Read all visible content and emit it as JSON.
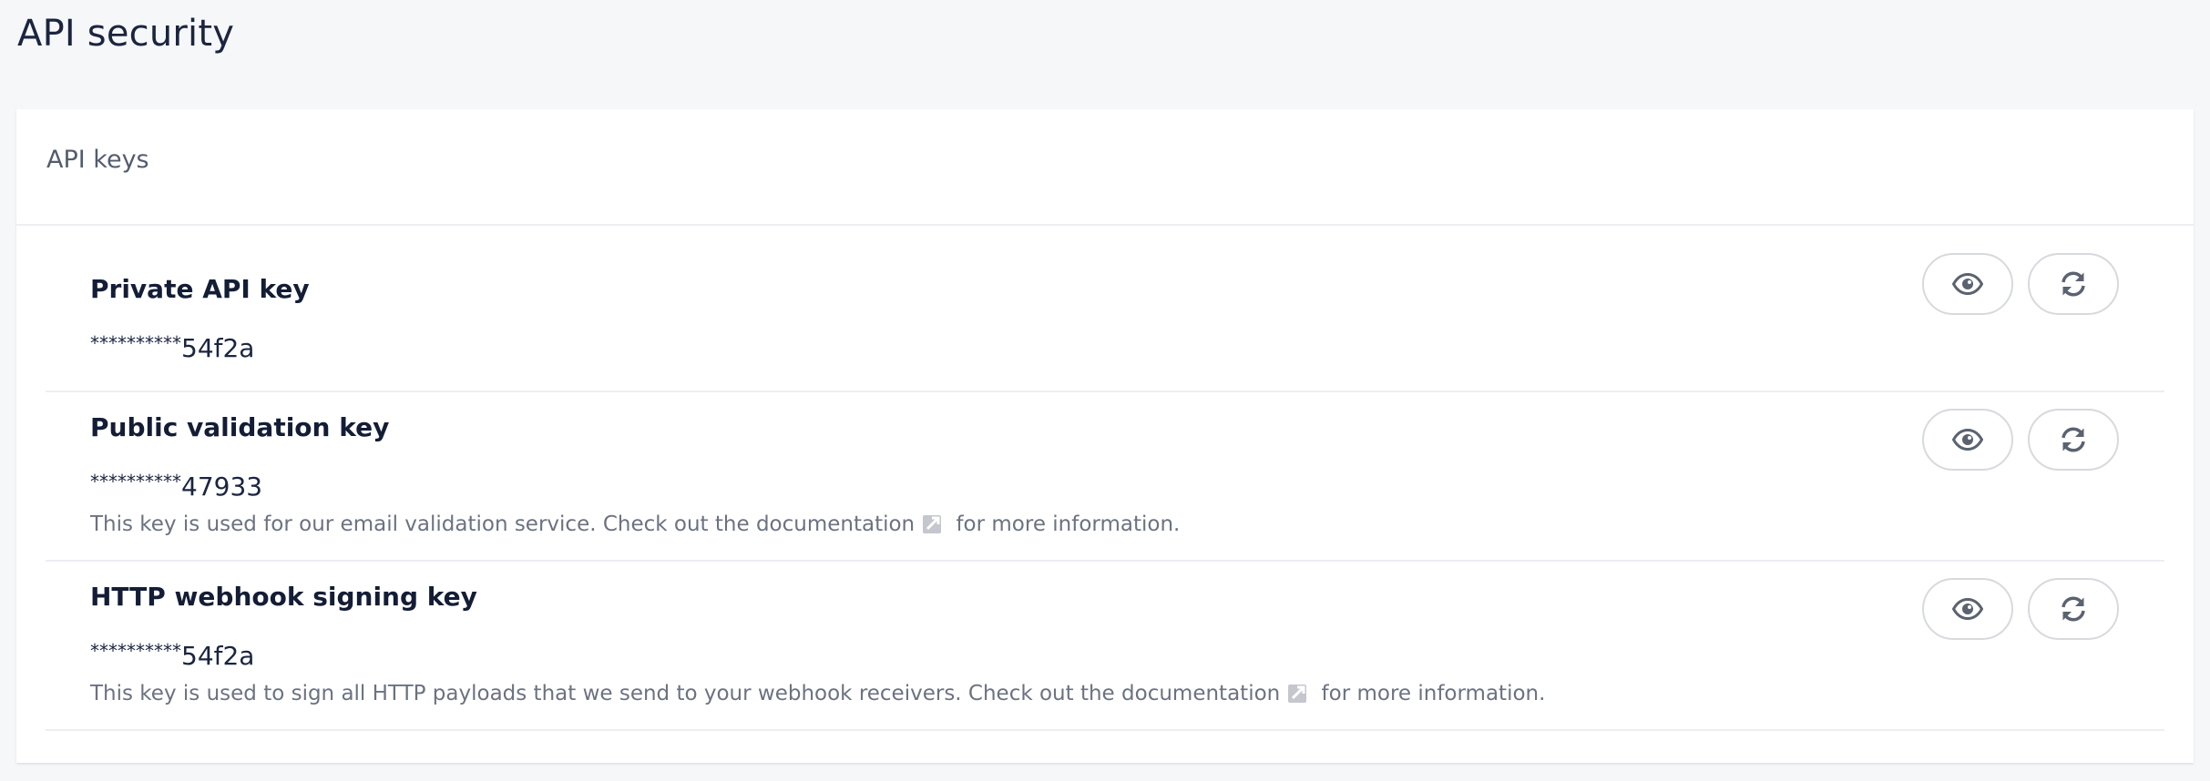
{
  "page": {
    "title": "API security"
  },
  "card": {
    "title": "API keys"
  },
  "keys": [
    {
      "name": "Private API key",
      "mask": "**********",
      "suffix": "54f2a",
      "description_before": "",
      "link_label": "",
      "description_after": ""
    },
    {
      "name": "Public validation key",
      "mask": "**********",
      "suffix": "47933",
      "description_before": "This key is used for our email validation service. Check out the ",
      "link_label": "documentation",
      "description_after": " for more information."
    },
    {
      "name": "HTTP webhook signing key",
      "mask": "**********",
      "suffix": "54f2a",
      "description_before": "This key is used to sign all HTTP payloads that we send to your webhook receivers. Check out the ",
      "link_label": "documentation",
      "description_after": " for more information."
    }
  ],
  "icons": {
    "view": "eye-icon",
    "regenerate": "refresh-icon",
    "external": "external-link-icon"
  },
  "colors": {
    "page_background": "#f6f7f9",
    "card_background": "#ffffff",
    "icon": "#5b6270",
    "border": "#d7d9de"
  }
}
